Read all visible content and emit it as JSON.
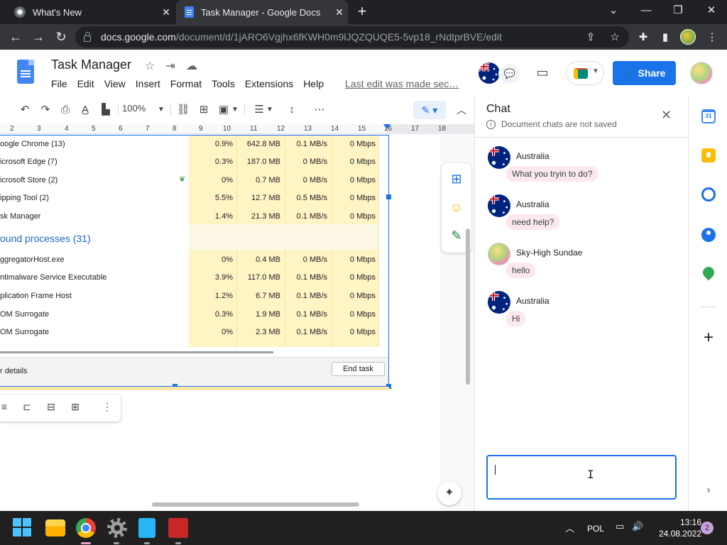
{
  "browser": {
    "tabs": [
      {
        "title": "What's New",
        "close": "✕"
      },
      {
        "title": "Task Manager - Google Docs",
        "close": "✕"
      }
    ],
    "new_tab": "+",
    "url_host": "docs.google.com",
    "url_path": "/document/d/1jARO6Vgjhx6fKWH0m9lJQZQUQE5-5vp18_rNdtprBVE/edit"
  },
  "docs": {
    "title": "Task Manager",
    "menu": [
      "File",
      "Edit",
      "View",
      "Insert",
      "Format",
      "Tools",
      "Extensions",
      "Help"
    ],
    "last_edit": "Last edit was made sec…",
    "share_label": "Share",
    "zoom": "100%",
    "ruler_numbers": [
      "2",
      "3",
      "4",
      "5",
      "6",
      "7",
      "8",
      "9",
      "10",
      "11",
      "12",
      "13",
      "14",
      "15",
      "16",
      "17",
      "18"
    ]
  },
  "task_manager": {
    "rows": [
      {
        "name": "oogle Chrome (13)",
        "cpu": "0.9%",
        "mem": "642.8 MB",
        "disk": "0.1 MB/s",
        "net": "0 Mbps"
      },
      {
        "name": "icrosoft Edge (7)",
        "cpu": "0.3%",
        "mem": "187.0 MB",
        "disk": "0 MB/s",
        "net": "0 Mbps"
      },
      {
        "name": "icrosoft Store (2)",
        "cpu": "0%",
        "mem": "0.7 MB",
        "disk": "0 MB/s",
        "net": "0 Mbps"
      },
      {
        "name": "ipping Tool (2)",
        "cpu": "5.5%",
        "mem": "12.7 MB",
        "disk": "0.5 MB/s",
        "net": "0 Mbps"
      },
      {
        "name": "sk Manager",
        "cpu": "1.4%",
        "mem": "21.3 MB",
        "disk": "0.1 MB/s",
        "net": "0 Mbps"
      }
    ],
    "group_label": "ound processes (31)",
    "bg_rows": [
      {
        "name": "ggregatorHost.exe",
        "cpu": "0%",
        "mem": "0.4 MB",
        "disk": "0 MB/s",
        "net": "0 Mbps"
      },
      {
        "name": "ntimalware Service Executable",
        "cpu": "3.9%",
        "mem": "117.0 MB",
        "disk": "0.1 MB/s",
        "net": "0 Mbps"
      },
      {
        "name": "plication Frame Host",
        "cpu": "1.2%",
        "mem": "6.7 MB",
        "disk": "0.1 MB/s",
        "net": "0 Mbps"
      },
      {
        "name": "OM Surrogate",
        "cpu": "0.3%",
        "mem": "1.9 MB",
        "disk": "0.1 MB/s",
        "net": "0 Mbps"
      },
      {
        "name": "OM Surrogate",
        "cpu": "0%",
        "mem": "2.3 MB",
        "disk": "0.1 MB/s",
        "net": "0 Mbps"
      }
    ],
    "details_label": "r details",
    "end_task_label": "End task"
  },
  "chat": {
    "title": "Chat",
    "subtitle": "Document chats are not saved",
    "messages": [
      {
        "author": "Australia",
        "text": "What you tryin to do?"
      },
      {
        "author": "Australia",
        "text": "need help?"
      },
      {
        "author": "Sky-High Sundae",
        "text": "hello"
      },
      {
        "author": "Australia",
        "text": "Hi"
      }
    ],
    "input_value": ""
  },
  "taskbar": {
    "tray_lang": "POL",
    "time": "13:16",
    "date": "24.08.2022",
    "notifications": "2"
  },
  "colors": {
    "accent": "#1a73e8",
    "chrome_dark": "#202124",
    "highlight": "#fff4c4",
    "bubble": "#fce8ef"
  }
}
